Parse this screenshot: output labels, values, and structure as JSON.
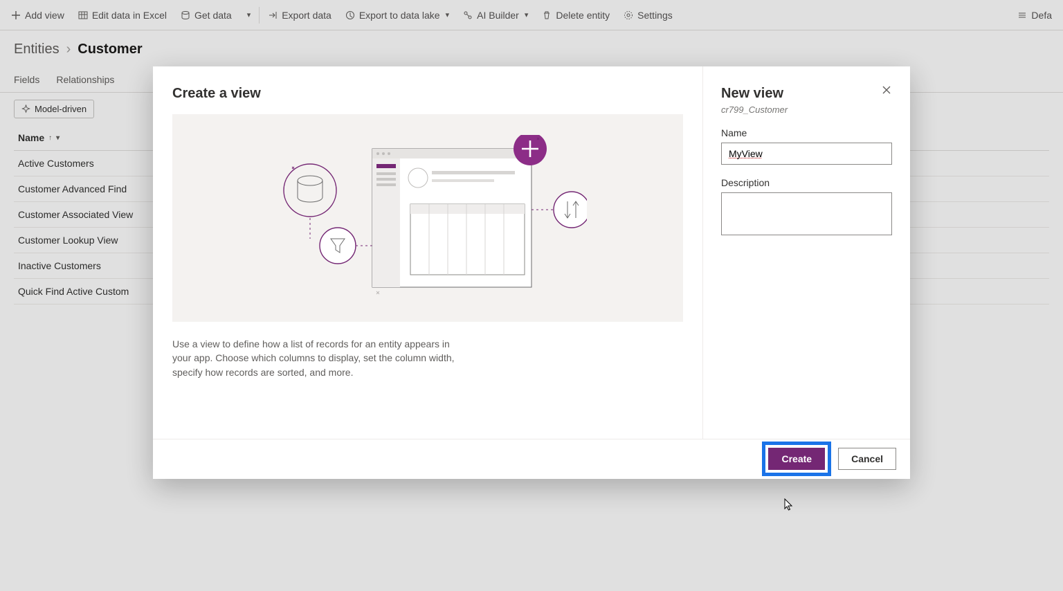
{
  "commandbar": {
    "add_view": "Add view",
    "edit_excel": "Edit data in Excel",
    "get_data": "Get data",
    "export_data": "Export data",
    "export_lake": "Export to data lake",
    "ai_builder": "AI Builder",
    "delete_entity": "Delete entity",
    "settings": "Settings",
    "right_label": "Defa"
  },
  "breadcrumb": {
    "root": "Entities",
    "current": "Customer"
  },
  "tabs": {
    "fields": "Fields",
    "relationships": "Relationships"
  },
  "filter": {
    "model_driven": "Model-driven"
  },
  "table": {
    "header": "Name",
    "rows": [
      "Active Customers",
      "Customer Advanced Find",
      "Customer Associated View",
      "Customer Lookup View",
      "Inactive Customers",
      "Quick Find Active Custom"
    ]
  },
  "modal": {
    "left_title": "Create a view",
    "description": "Use a view to define how a list of records for an entity appears in your app. Choose which columns to display, set the column width, specify how records are sorted, and more.",
    "right_title": "New view",
    "subtitle": "cr799_Customer",
    "name_label": "Name",
    "name_value": "MyView",
    "desc_label": "Description",
    "desc_value": "",
    "create": "Create",
    "cancel": "Cancel"
  },
  "colors": {
    "accent": "#742774",
    "highlight": "#1a73e8"
  }
}
